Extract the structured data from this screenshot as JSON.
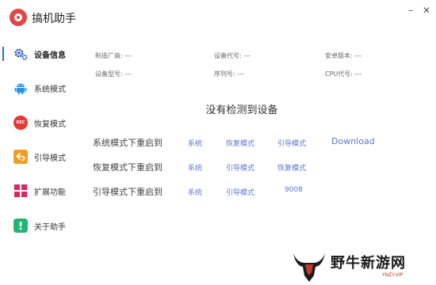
{
  "app": {
    "title": "搞机助手",
    "minimize": "–",
    "close": "✕"
  },
  "sidebar": {
    "items": [
      {
        "label": "设备信息",
        "icon": "gear-icon",
        "active": true
      },
      {
        "label": "系统模式",
        "icon": "android-icon"
      },
      {
        "label": "恢复模式",
        "icon": "rec-icon",
        "icon_text": "REC"
      },
      {
        "label": "引导模式",
        "icon": "back-arrow-icon"
      },
      {
        "label": "扩展功能",
        "icon": "grid-icon"
      },
      {
        "label": "关于助手",
        "icon": "info-icon"
      }
    ]
  },
  "device_info": {
    "manufacturer": "制造厂商: ---",
    "device_code": "设备代号: ---",
    "android_version": "安卓版本: ---",
    "model": "设备型号: ---",
    "serial": "序列号: ---",
    "cpu_code": "CPU代号: ---"
  },
  "status": {
    "headline": "没有检测到设备"
  },
  "reboot": {
    "rows": [
      {
        "label": "系统模式下重启到",
        "targets": [
          "系统",
          "恢复模式",
          "引导模式",
          "Download"
        ]
      },
      {
        "label": "恢复模式下重启到",
        "targets": [
          "系统",
          "引导模式",
          "恢复模式"
        ]
      },
      {
        "label": "引导模式下重启到",
        "targets": [
          "系统",
          "引导模式",
          "9008"
        ]
      }
    ]
  },
  "watermark": {
    "text": "野牛新游网",
    "sub": "YNZY.VIP"
  },
  "colors": {
    "accent": "#2f6fd0",
    "link": "#5b78d0",
    "android": "#2196f3",
    "rec": "#e53935",
    "back": "#f0a020",
    "grid": "#e0245e",
    "info": "#22b573",
    "logo": "#e04848"
  }
}
